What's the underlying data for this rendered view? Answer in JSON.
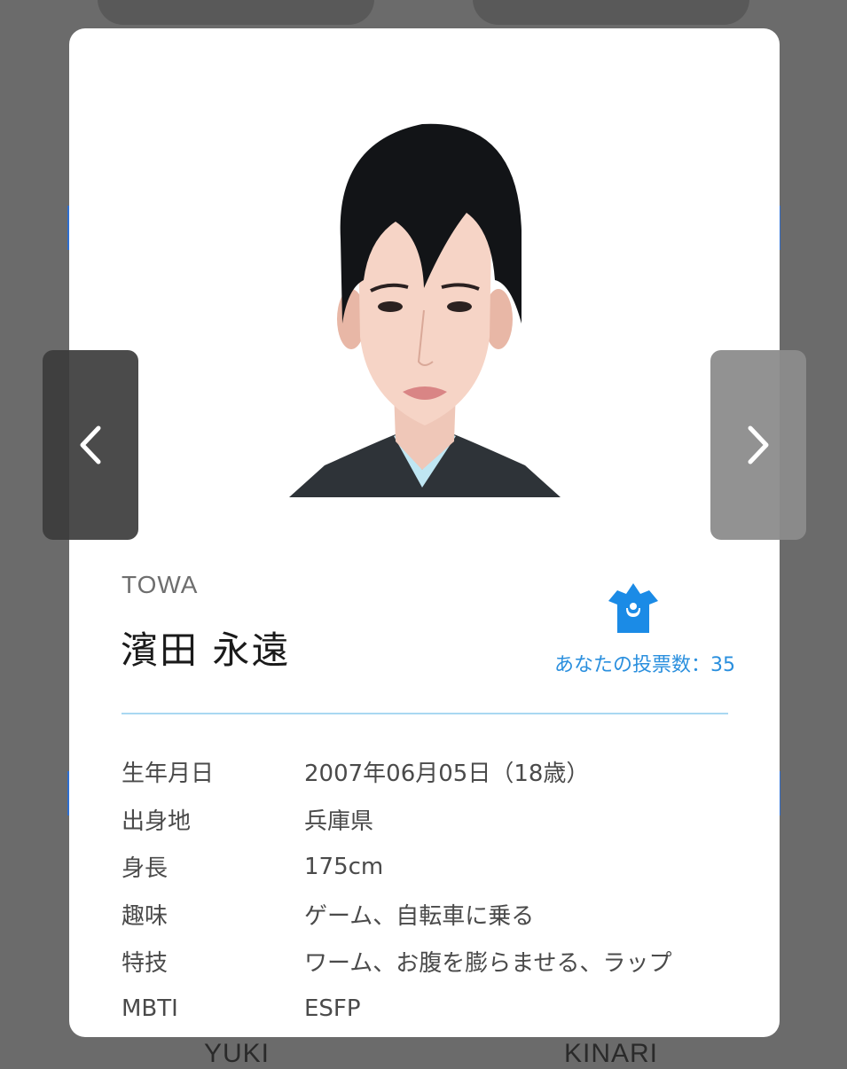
{
  "background": {
    "names": [
      "YUKI",
      "KINARI"
    ]
  },
  "profile_card": {
    "romaji": "TOWA",
    "name": "濱田 永遠",
    "votes_text": "あなたの投票数：35",
    "accent_color": "#2a8fde",
    "crown_icon": "crown-icon",
    "details": [
      {
        "label": "生年月日",
        "value": "2007年06月05日（18歳）"
      },
      {
        "label": "出身地",
        "value": "兵庫県"
      },
      {
        "label": "身長",
        "value": "175cm"
      },
      {
        "label": "趣味",
        "value": "ゲーム、自転車に乗る"
      },
      {
        "label": "特技",
        "value": "ワーム、お腹を膨らませる、ラップ"
      },
      {
        "label": "MBTI",
        "value": "ESFP"
      }
    ]
  },
  "nav": {
    "prev_icon": "chevron-left-icon",
    "next_icon": "chevron-right-icon"
  }
}
